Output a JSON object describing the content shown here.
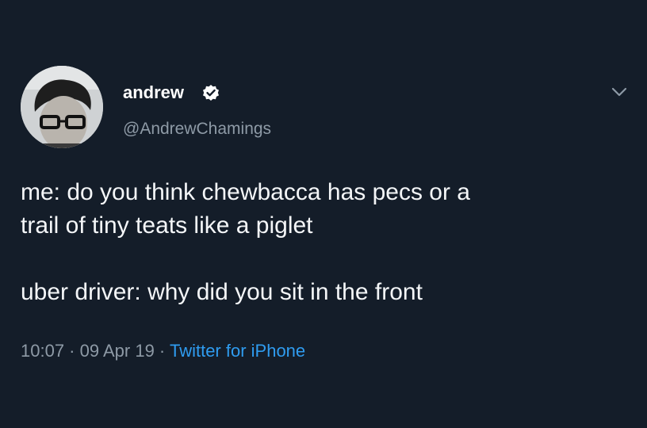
{
  "tweet": {
    "author": {
      "display_name": "andrew",
      "handle": "@AndrewChamings",
      "verified": true
    },
    "text_paragraphs": [
      "me: do you think chewbacca has pecs or a\ntrail of tiny teats like a piglet",
      "uber driver: why did you sit in the front"
    ],
    "meta": {
      "time": "10:07",
      "separator": " · ",
      "date": "09 Apr 19",
      "source": "Twitter for iPhone"
    }
  },
  "colors": {
    "background": "#141d29",
    "text": "#f4f6f8",
    "secondary_text": "#8e9aa6",
    "link": "#2f9cf0"
  },
  "icons": {
    "verified": "verified-badge-icon",
    "menu": "chevron-down-icon"
  }
}
